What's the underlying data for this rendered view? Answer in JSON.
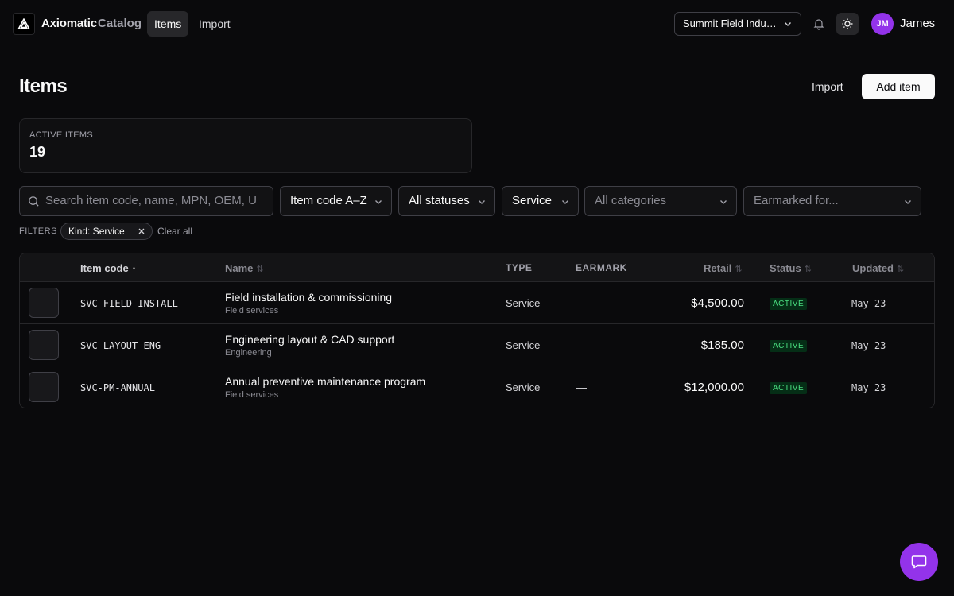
{
  "app": {
    "brand": "Axiomatic",
    "brand_sub": "Catalog"
  },
  "nav": {
    "tabs": [
      {
        "label": "Items",
        "active": true
      },
      {
        "label": "Import",
        "active": false
      }
    ]
  },
  "header_right": {
    "org": "Summit Field Indu…",
    "user_initials": "JM",
    "user_name": "James"
  },
  "page": {
    "title": "Items",
    "import_label": "Import",
    "add_label": "Add item"
  },
  "stats": {
    "active_label": "ACTIVE ITEMS",
    "active_value": "19"
  },
  "controls": {
    "search_placeholder": "Search item code, name, MPN, OEM, U",
    "sort": "Item code A–Z",
    "status": "All statuses",
    "kind": "Service",
    "category": "All categories",
    "earmark": "Earmarked for..."
  },
  "filters": {
    "label": "FILTERS",
    "chip": "Kind: Service",
    "clear": "Clear all"
  },
  "table": {
    "columns": {
      "code": "Item code",
      "name": "Name",
      "type": "TYPE",
      "earmark": "EARMARK",
      "retail": "Retail",
      "status": "Status",
      "updated": "Updated"
    },
    "rows": [
      {
        "code": "SVC-FIELD-INSTALL",
        "name": "Field installation & commissioning",
        "category": "Field services",
        "type": "Service",
        "earmark": "—",
        "retail": "$4,500.00",
        "status": "ACTIVE",
        "updated": "May 23"
      },
      {
        "code": "SVC-LAYOUT-ENG",
        "name": "Engineering layout & CAD support",
        "category": "Engineering",
        "type": "Service",
        "earmark": "—",
        "retail": "$185.00",
        "status": "ACTIVE",
        "updated": "May 23"
      },
      {
        "code": "SVC-PM-ANNUAL",
        "name": "Annual preventive maintenance program",
        "category": "Field services",
        "type": "Service",
        "earmark": "—",
        "retail": "$12,000.00",
        "status": "ACTIVE",
        "updated": "May 23"
      }
    ]
  },
  "icons": [
    "logo-icon",
    "bell-icon",
    "sun-icon",
    "chevron-down-icon",
    "search-icon",
    "close-icon",
    "sort-asc-icon",
    "sort-icon",
    "chat-icon"
  ],
  "colors": {
    "accent": "#9333ea",
    "active_badge_bg": "#052e16",
    "active_badge_text": "#4ade80",
    "background": "#0a0a0c"
  }
}
